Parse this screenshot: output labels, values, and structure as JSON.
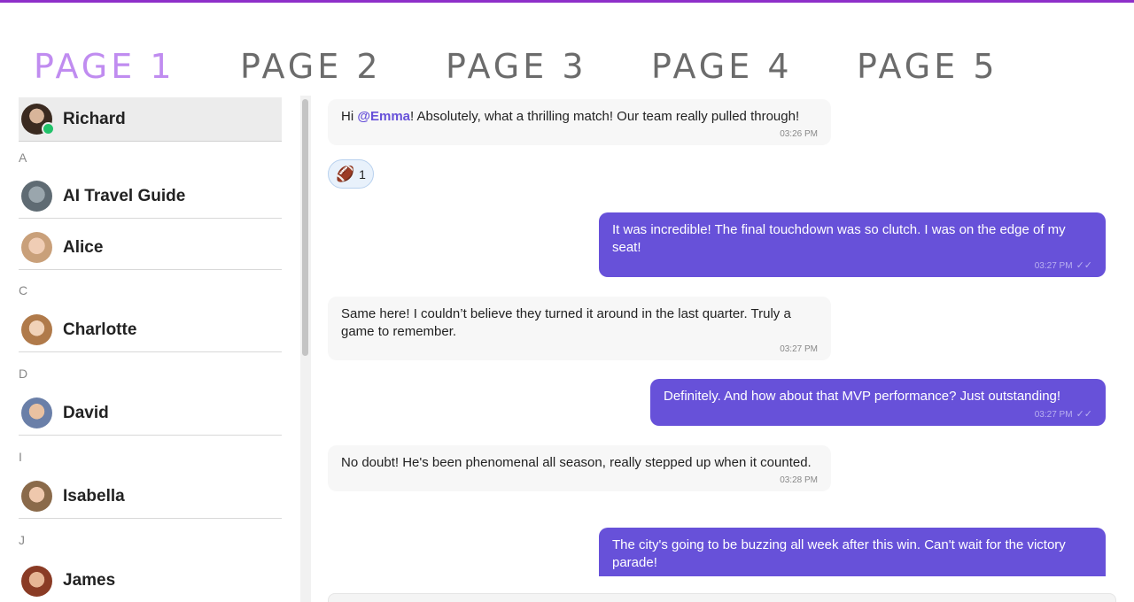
{
  "tabs": [
    "PAGE 1",
    "PAGE 2",
    "PAGE 3",
    "PAGE 4",
    "PAGE 5"
  ],
  "active_tab": 0,
  "colors": {
    "accent": "#6751d9",
    "active_tab": "#c08cf0",
    "online": "#21c26a",
    "top_bar": "#8e2fc9"
  },
  "sidebar": {
    "selected": {
      "name": "Richard",
      "status": "online"
    },
    "groups": [
      {
        "letter": "A",
        "contacts": [
          "AI Travel Guide",
          "Alice"
        ]
      },
      {
        "letter": "C",
        "contacts": [
          "Charlotte"
        ]
      },
      {
        "letter": "D",
        "contacts": [
          "David"
        ]
      },
      {
        "letter": "I",
        "contacts": [
          "Isabella"
        ]
      },
      {
        "letter": "J",
        "contacts": [
          "James"
        ]
      }
    ]
  },
  "chat": {
    "messages": [
      {
        "direction": "in",
        "mention": "@Emma",
        "text_before": "Hi ",
        "text_after": "! Absolutely, what a thrilling match! Our team really pulled through!",
        "time": "03:26 PM"
      },
      {
        "direction": "out",
        "text": "It was incredible! The final touchdown was so clutch. I was on the edge of my seat!",
        "time": "03:27 PM"
      },
      {
        "direction": "in",
        "text": "Same here! I couldn’t believe they turned it around in the last quarter. Truly a game to remember.",
        "time": "03:27 PM"
      },
      {
        "direction": "out",
        "text": "Definitely. And how about that MVP performance? Just outstanding!",
        "time": "03:27 PM"
      },
      {
        "direction": "in",
        "text": "No doubt! He's been phenomenal all season, really stepped up when it counted.",
        "time": "03:28 PM"
      },
      {
        "direction": "out",
        "text": "The city's going to be buzzing all week after this win. Can't wait for the victory parade!",
        "time": ""
      }
    ],
    "reaction": {
      "emoji": "🏈",
      "count": "1"
    },
    "read_ticks": "✓✓"
  }
}
